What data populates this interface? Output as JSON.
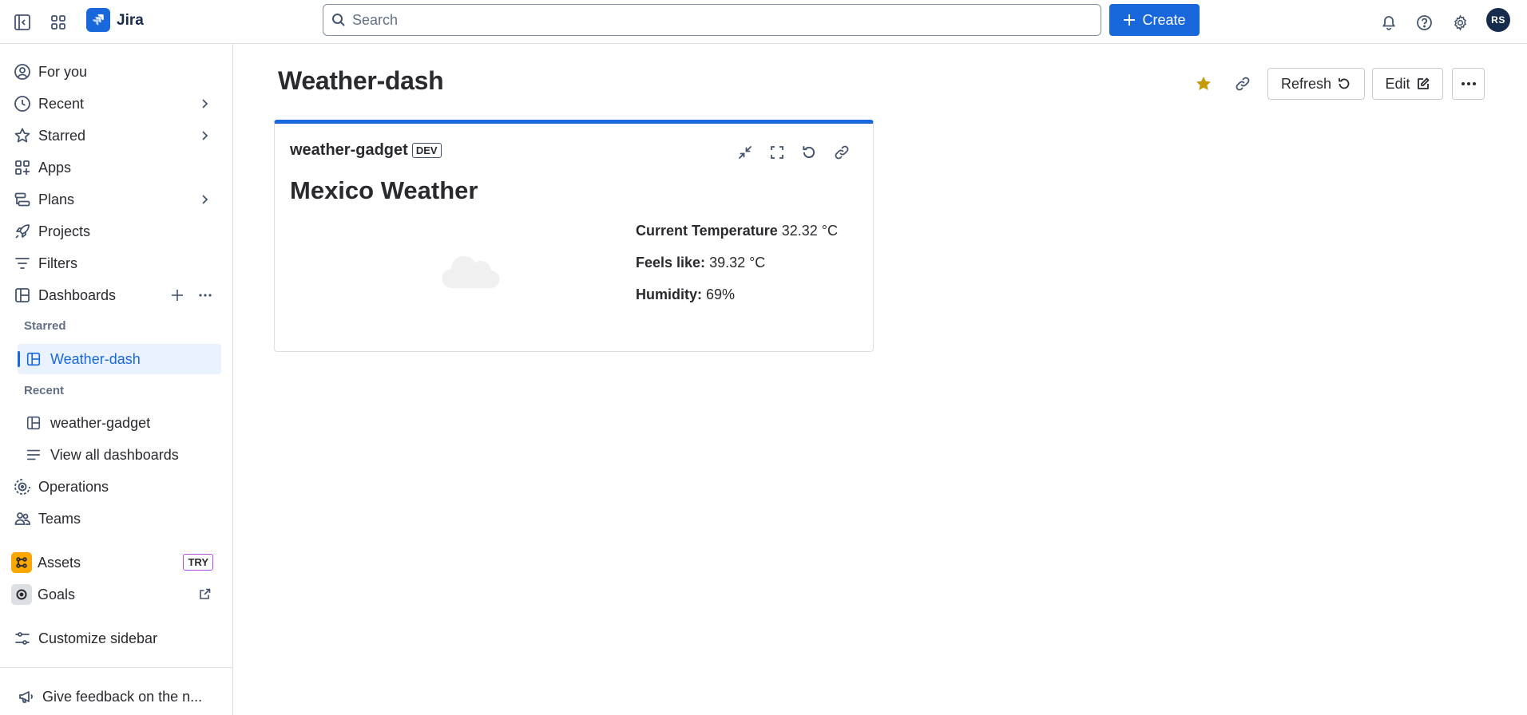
{
  "topbar": {
    "app_name": "Jira",
    "search_placeholder": "Search",
    "create_label": "Create",
    "avatar_initials": "RS"
  },
  "sidebar": {
    "items": [
      {
        "label": "For you",
        "icon": "user-circle-icon"
      },
      {
        "label": "Recent",
        "icon": "clock-icon"
      },
      {
        "label": "Starred",
        "icon": "star-icon"
      },
      {
        "label": "Apps",
        "icon": "apps-icon"
      },
      {
        "label": "Plans",
        "icon": "plans-icon"
      },
      {
        "label": "Projects",
        "icon": "rocket-icon"
      },
      {
        "label": "Filters",
        "icon": "filter-icon"
      },
      {
        "label": "Dashboards",
        "icon": "dashboard-icon"
      }
    ],
    "starred_label": "Starred",
    "recent_label": "Recent",
    "starred_dash": "Weather-dash",
    "recent_dash": "weather-gadget",
    "view_all": "View all dashboards",
    "operations": "Operations",
    "teams": "Teams",
    "assets": "Assets",
    "try_badge": "TRY",
    "goals": "Goals",
    "customize": "Customize sidebar",
    "feedback": "Give feedback on the n..."
  },
  "main": {
    "title": "Weather-dash",
    "refresh_label": "Refresh",
    "edit_label": "Edit"
  },
  "gadget": {
    "name": "weather-gadget",
    "env_badge": "DEV",
    "heading": "Mexico Weather",
    "temp_label": "Current Temperature",
    "temp_value": "32.32 °C",
    "feels_label": "Feels like:",
    "feels_value": "39.32 °C",
    "humidity_label": "Humidity:",
    "humidity_value": "69%"
  },
  "colors": {
    "brand": "#1868db",
    "star": "#c69a07",
    "assets_icon_bg": "#fca700"
  }
}
